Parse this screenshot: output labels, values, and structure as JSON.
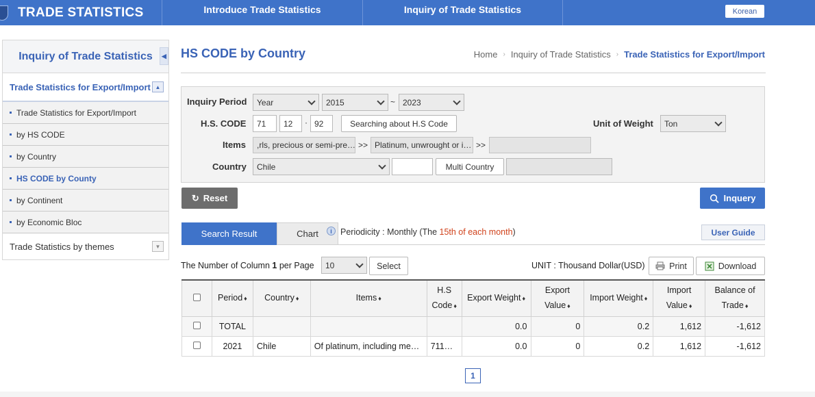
{
  "header": {
    "brand": "TRADE STATISTICS",
    "nav": [
      "Introduce Trade Statistics",
      "Inquiry of Trade Statistics"
    ],
    "lang_button": "Korean"
  },
  "sidebar": {
    "title": "Inquiry of Trade Statistics",
    "section": "Trade Statistics for Export/Import",
    "items": [
      {
        "label": "Trade Statistics for Export/Import"
      },
      {
        "label": "by HS CODE"
      },
      {
        "label": "by Country"
      },
      {
        "label": "HS CODE by County"
      },
      {
        "label": "by Continent"
      },
      {
        "label": "by Economic Bloc"
      }
    ],
    "themes": "Trade Statistics by themes"
  },
  "page": {
    "title": "HS CODE by Country",
    "breadcrumb": [
      "Home",
      "Inquiry of Trade Statistics",
      "Trade Statistics for Export/Import"
    ]
  },
  "form": {
    "inquiry_period_label": "Inquiry Period",
    "period_type": "Year",
    "from_year": "2015",
    "tilde": "~",
    "to_year": "2023",
    "hs_code_label": "H.S. CODE",
    "hs1": "71",
    "hs2": "12",
    "dot": "·",
    "hs3": "92",
    "hs_search_button": "Searching about H.S Code",
    "unit_weight_label": "Unit of Weight",
    "unit_weight": "Ton",
    "items_label": "Items",
    "item1": ",rls, precious or semi-pre…",
    "arrow": ">>",
    "item2": "Platinum, unwrought or i…",
    "item3": "",
    "country_label": "Country",
    "country": "Chile",
    "country_text": "",
    "multi_country_button": "Multi Country",
    "country_extra": "",
    "reset_button": "Reset",
    "inquery_button": "Inquery"
  },
  "tabs": {
    "search_result": "Search Result",
    "chart": "Chart",
    "info_glyph": "i",
    "periodicity_prefix": "Periodicity : Monthly (The ",
    "periodicity_highlight": "15th of each month",
    "periodicity_suffix": ")",
    "user_guide": "User Guide"
  },
  "controls": {
    "columns_prefix": "The Number of Column ",
    "columns_value": "1",
    "per_page_label": "  per Page",
    "per_page": "10",
    "select_button": "Select",
    "unit_label": "UNIT : Thousand Dollar(USD)",
    "print_button": "Print",
    "download_button": "Download"
  },
  "table": {
    "headers": {
      "period": "Period",
      "country": "Country",
      "items": "Items",
      "hs_line1": "H.S",
      "hs_line2": "Code",
      "export_weight": "Export Weight",
      "export_value_line1": "Export",
      "export_value_line2": "Value",
      "import_weight": "Import Weight",
      "import_value_line1": "Import",
      "import_value_line2": "Value",
      "balance_line1": "Balance of",
      "balance_line2": "Trade"
    },
    "sort_glyph": "♦",
    "rows": [
      {
        "period": "TOTAL",
        "country": "",
        "items": "",
        "hs": "",
        "export_weight": "0.0",
        "export_value": "0",
        "import_weight": "0.2",
        "import_value": "1,612",
        "balance": "-1,612"
      },
      {
        "period": "2021",
        "country": "Chile",
        "items": "Of platinum, including me…",
        "hs": "711…",
        "export_weight": "0.0",
        "export_value": "0",
        "import_weight": "0.2",
        "import_value": "1,612",
        "balance": "-1,612"
      }
    ]
  },
  "pagination": {
    "current": "1"
  },
  "colors": {
    "brand_blue": "#3f73c9",
    "highlight_red": "#d0421b"
  }
}
